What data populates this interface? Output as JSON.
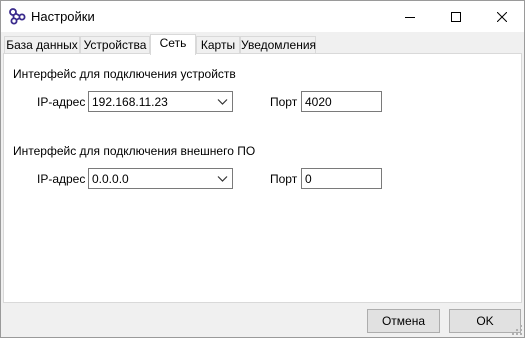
{
  "window": {
    "title": "Настройки",
    "icon": "graph-nodes-icon",
    "controls": [
      "minimize-icon",
      "maximize-icon",
      "close-icon"
    ]
  },
  "tabs": [
    {
      "label": "База данных",
      "active": false
    },
    {
      "label": "Устройства",
      "active": false
    },
    {
      "label": "Сеть",
      "active": true
    },
    {
      "label": "Карты",
      "active": false
    },
    {
      "label": "Уведомления",
      "active": false
    }
  ],
  "network": {
    "devices_section": {
      "title": "Интерфейс для подключения устройств",
      "ip_label": "IP-адрес",
      "ip_value": "192.168.11.23",
      "port_label": "Порт",
      "port_value": "4020"
    },
    "external_section": {
      "title": "Интерфейс для подключения внешнего ПО",
      "ip_label": "IP-адрес",
      "ip_value": "0.0.0.0",
      "port_label": "Порт",
      "port_value": "0"
    }
  },
  "buttons": {
    "cancel": "Отмена",
    "ok": "OK"
  },
  "colors": {
    "accent_icon": "#3a2a8c",
    "button_face": "#e1e1e1",
    "window_bg": "#f0f0f0"
  }
}
